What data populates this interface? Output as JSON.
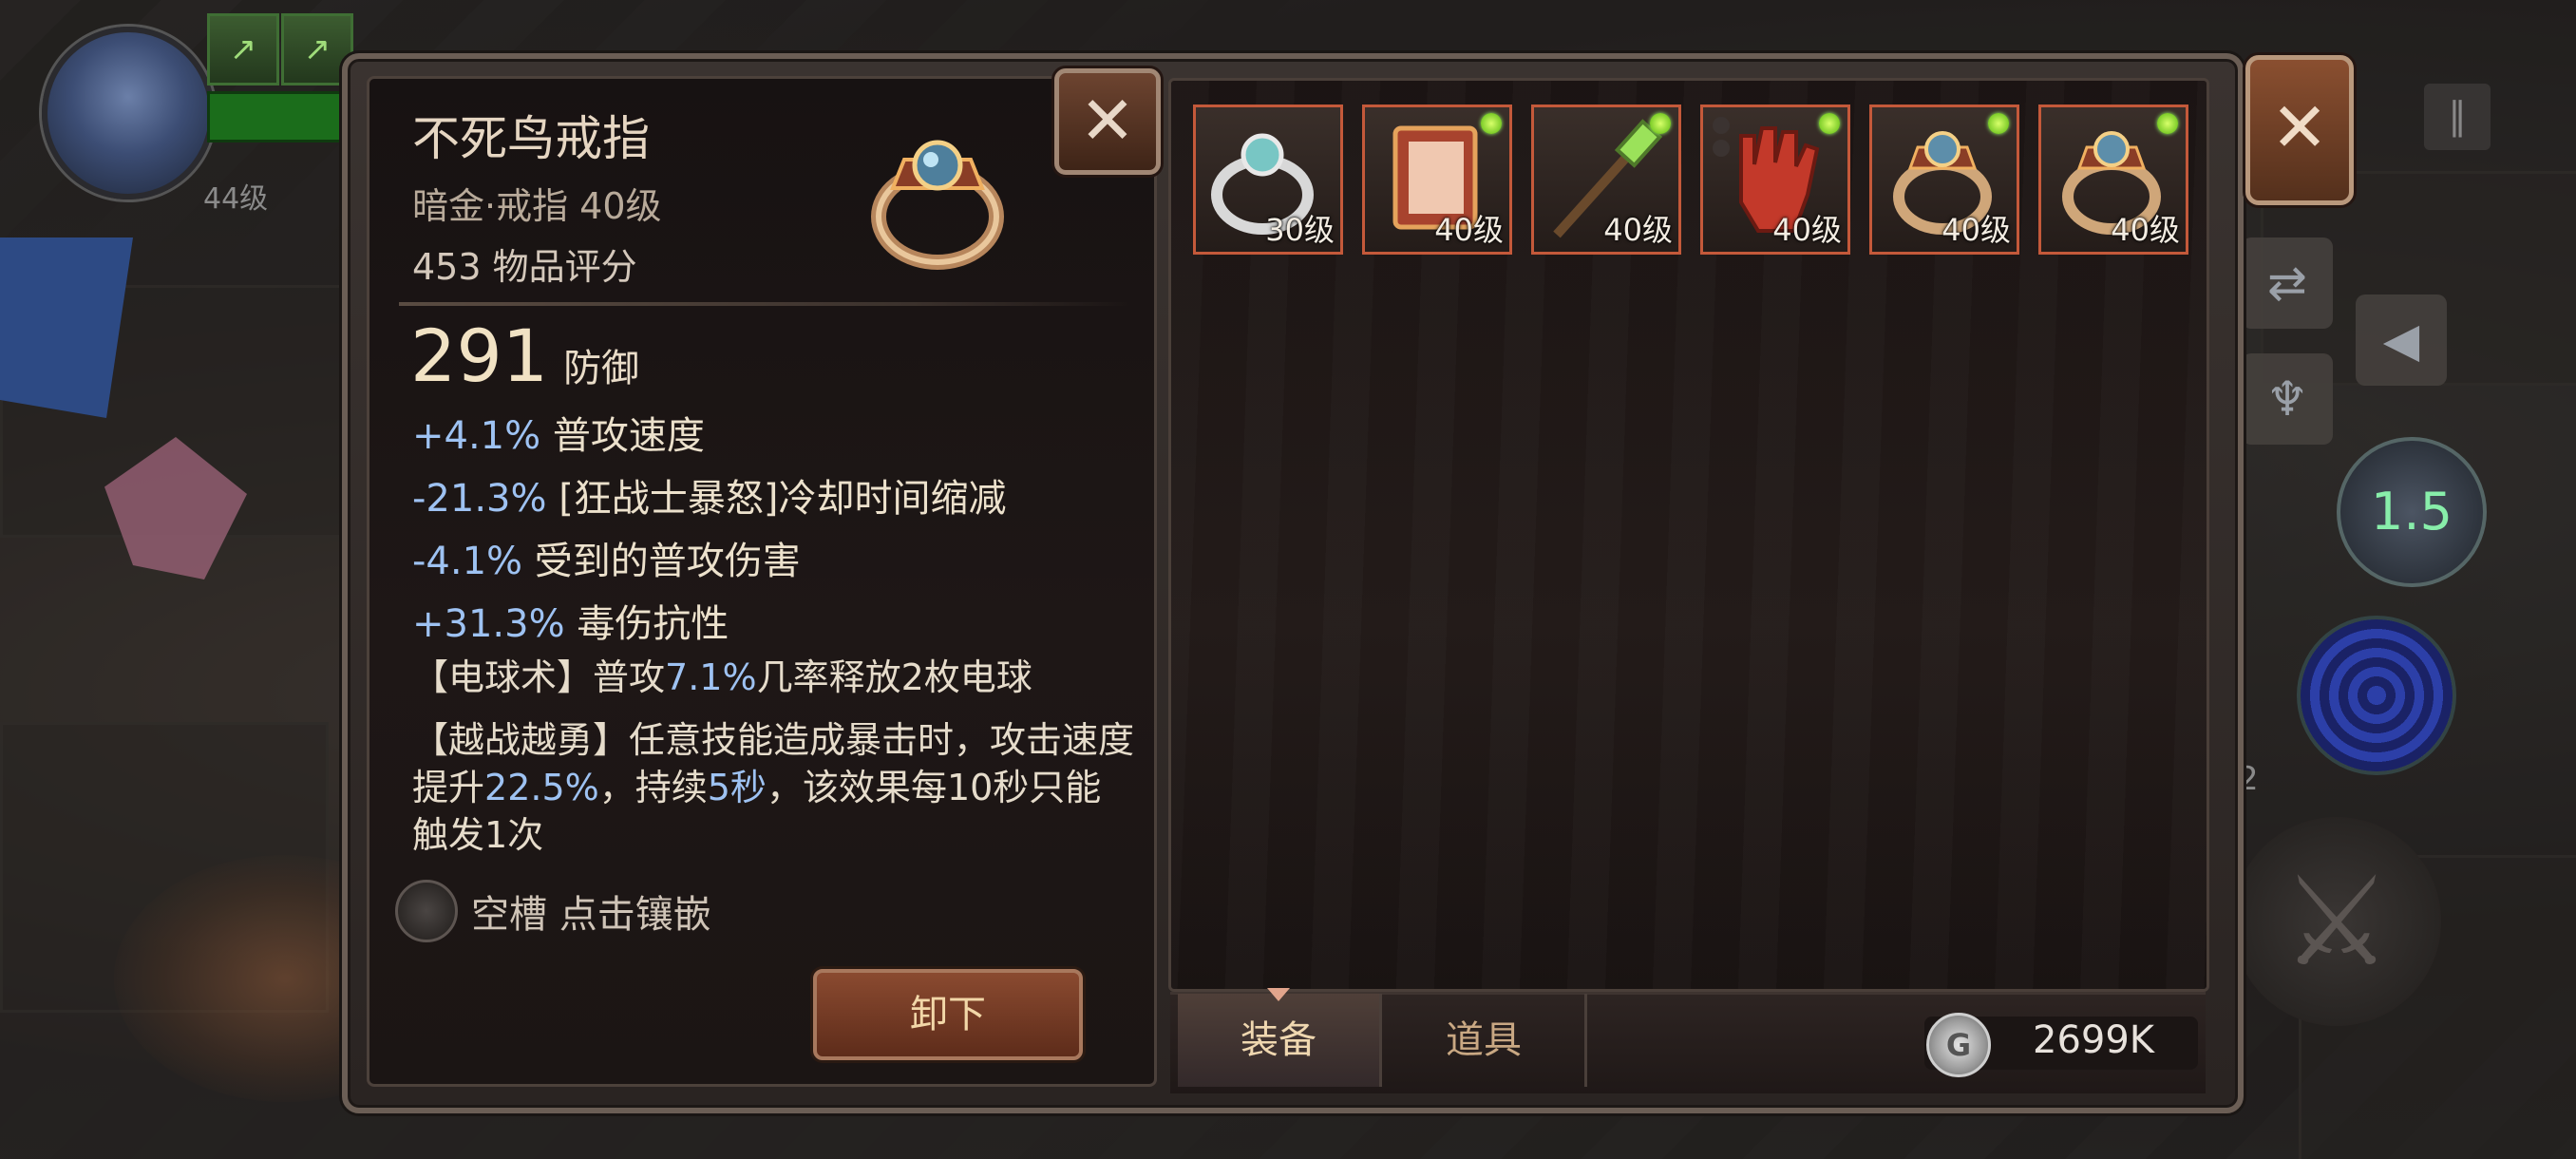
{
  "hud": {
    "player_level": "44级",
    "cooldown_text": "1.5",
    "side_count": "2"
  },
  "item": {
    "name": "不死鸟戒指",
    "type": "暗金·戒指 40级",
    "score": "453 物品评分",
    "main_value": "291",
    "main_label": "防御",
    "stats": [
      {
        "value": "+4.1%",
        "label": "普攻速度"
      },
      {
        "value": "-21.3%",
        "label": "[狂战士暴怒]冷却时间缩减"
      },
      {
        "value": "-4.1%",
        "label": "受到的普攻伤害"
      },
      {
        "value": "+31.3%",
        "label": "毒伤抗性"
      }
    ],
    "effect1": {
      "p1": "【电球术】普攻",
      "v1": "7.1%",
      "p2": "几率释放2枚电球"
    },
    "effect2": {
      "p1": "【越战越勇】任意技能造成暴击时，攻击速度提升",
      "v1": "22.5%",
      "p2": "，持续",
      "v2": "5秒",
      "p3": "，该效果每10秒只能触发1次"
    },
    "socket_label": "空槽 点击镶嵌",
    "unequip_label": "卸下"
  },
  "inventory": {
    "slots": [
      {
        "icon": "silver-ring",
        "level": "30级",
        "new": false
      },
      {
        "icon": "book",
        "level": "40级",
        "new": true
      },
      {
        "icon": "staff",
        "level": "40级",
        "new": true
      },
      {
        "icon": "red-glove",
        "level": "40级",
        "new": true
      },
      {
        "icon": "gold-ring",
        "level": "40级",
        "new": true
      },
      {
        "icon": "gold-ring",
        "level": "40级",
        "new": true
      }
    ],
    "tabs": {
      "equipment": "装备",
      "items": "道具"
    },
    "currency": "2699K",
    "coin_symbol": "G"
  },
  "colors": {
    "stat_value": "#9ec2f2",
    "new_dot": "#7ccc28",
    "slot_border": "#c4593a"
  }
}
